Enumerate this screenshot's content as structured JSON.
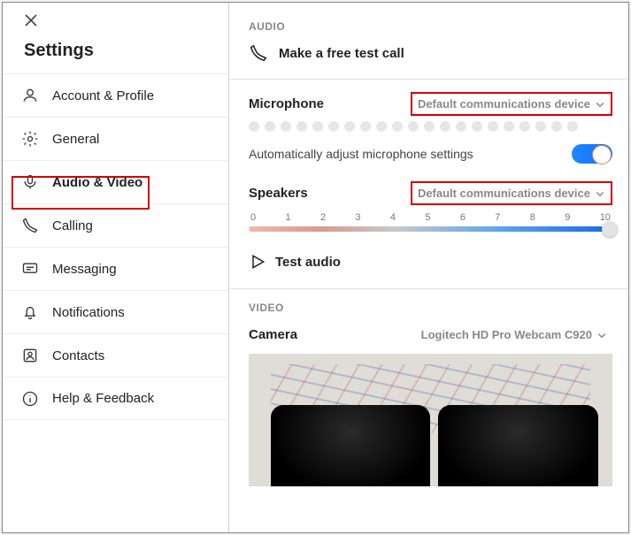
{
  "sidebar": {
    "title": "Settings",
    "items": [
      {
        "label": "Account & Profile"
      },
      {
        "label": "General"
      },
      {
        "label": "Audio & Video"
      },
      {
        "label": "Calling"
      },
      {
        "label": "Messaging"
      },
      {
        "label": "Notifications"
      },
      {
        "label": "Contacts"
      },
      {
        "label": "Help & Feedback"
      }
    ],
    "selected_index": 2
  },
  "audio": {
    "section_label": "AUDIO",
    "test_call_label": "Make a free test call",
    "microphone_label": "Microphone",
    "microphone_device": "Default communications device",
    "auto_adjust_label": "Automatically adjust microphone settings",
    "auto_adjust_value": true,
    "speakers_label": "Speakers",
    "speakers_device": "Default communications device",
    "speaker_scale": [
      "0",
      "1",
      "2",
      "3",
      "4",
      "5",
      "6",
      "7",
      "8",
      "9",
      "10"
    ],
    "speaker_volume": 10,
    "test_audio_label": "Test audio"
  },
  "video": {
    "section_label": "VIDEO",
    "camera_label": "Camera",
    "camera_device": "Logitech HD Pro Webcam C920"
  }
}
